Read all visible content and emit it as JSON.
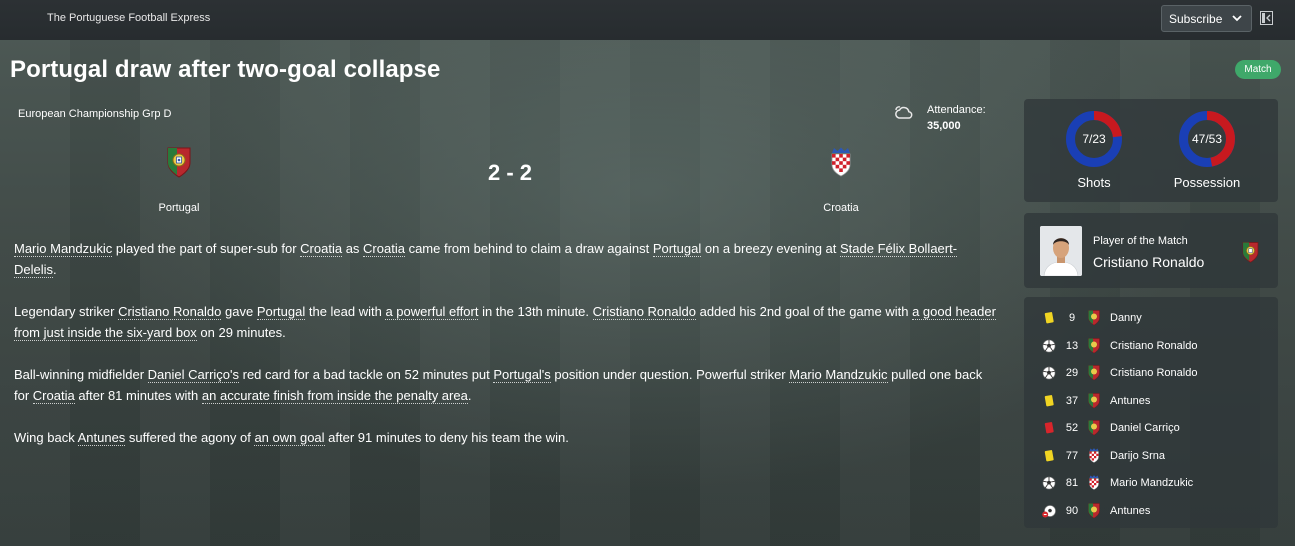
{
  "topbar": {
    "paper_name": "The Portuguese Football Express",
    "subscribe_label": "Subscribe"
  },
  "headline": "Portugal draw after two-goal collapse",
  "badge": "Match",
  "match": {
    "competition": "European Championship Grp D",
    "attendance_label": "Attendance:",
    "attendance_value": "35,000",
    "home_team": "Portugal",
    "away_team": "Croatia",
    "score": "2 - 2"
  },
  "article": {
    "p1": [
      "Mario Mandzukic",
      " played the part of super-sub for ",
      "Croatia",
      " as ",
      "Croatia",
      " came from behind to claim a draw against ",
      "Portugal",
      " on a breezy evening at ",
      "Stade Félix Bollaert-Delelis",
      "."
    ],
    "p2": [
      "Legendary striker ",
      "Cristiano Ronaldo",
      " gave ",
      "Portugal",
      " the lead with ",
      "a powerful effort",
      " in the 13th minute. ",
      "Cristiano Ronaldo",
      " added his 2nd goal of the game with ",
      "a good header from just inside the six-yard box",
      " on 29 minutes."
    ],
    "p3": [
      "Ball-winning midfielder ",
      "Daniel Carriço's",
      " red card for a bad tackle on 52 minutes put ",
      "Portugal's",
      " position under question. Powerful striker ",
      "Mario Mandzukic",
      " pulled one back for ",
      "Croatia",
      " after 81 minutes with ",
      "an accurate finish from inside the penalty area",
      "."
    ],
    "p4": [
      "Wing back ",
      "Antunes",
      " suffered the agony of ",
      "an own goal",
      " after 91 minutes to deny his team the win."
    ]
  },
  "stats": {
    "shots": {
      "label": "Shots",
      "text": "7/23",
      "home": 7,
      "away": 23
    },
    "possession": {
      "label": "Possession",
      "text": "47/53",
      "home": 47,
      "away": 53
    },
    "colors": {
      "home": "#c8191f",
      "away": "#1a3fb5"
    }
  },
  "potm": {
    "label": "Player of the Match",
    "name": "Cristiano Ronaldo"
  },
  "events": [
    {
      "type": "yellow-card",
      "minute": "9",
      "team": "portugal",
      "player": "Danny"
    },
    {
      "type": "goal",
      "minute": "13",
      "team": "portugal",
      "player": "Cristiano Ronaldo"
    },
    {
      "type": "goal",
      "minute": "29",
      "team": "portugal",
      "player": "Cristiano Ronaldo"
    },
    {
      "type": "yellow-card",
      "minute": "37",
      "team": "portugal",
      "player": "Antunes"
    },
    {
      "type": "red-card",
      "minute": "52",
      "team": "portugal",
      "player": "Daniel Carriço"
    },
    {
      "type": "yellow-card",
      "minute": "77",
      "team": "croatia",
      "player": "Darijo Srna"
    },
    {
      "type": "goal",
      "minute": "81",
      "team": "croatia",
      "player": "Mario Mandzukic"
    },
    {
      "type": "own-goal",
      "minute": "90",
      "team": "portugal",
      "player": "Antunes"
    }
  ]
}
